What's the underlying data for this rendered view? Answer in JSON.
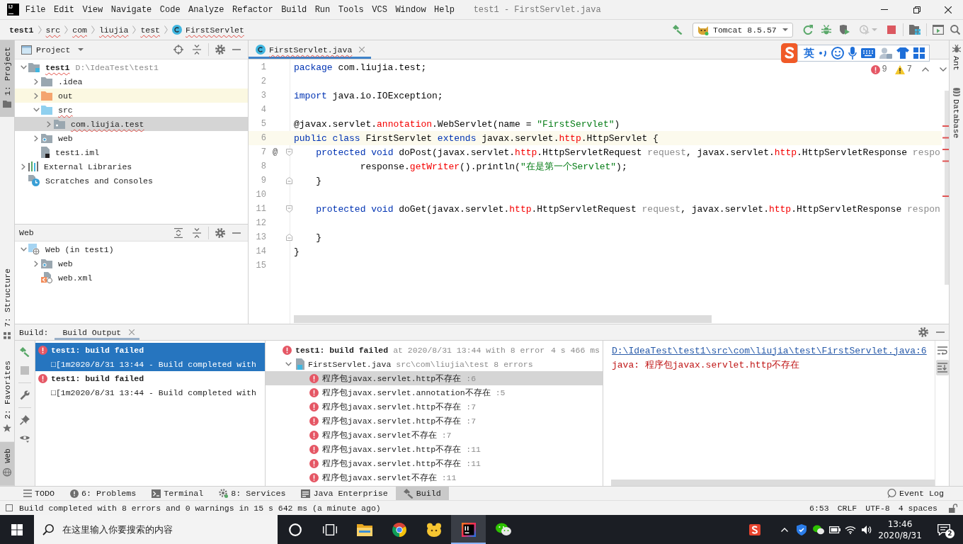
{
  "window": {
    "logo": "IJ",
    "menu": [
      "File",
      "Edit",
      "View",
      "Navigate",
      "Code",
      "Analyze",
      "Refactor",
      "Build",
      "Run",
      "Tools",
      "VCS",
      "Window",
      "Help"
    ],
    "title": "test1 - FirstServlet.java"
  },
  "navigation_bar": {
    "breadcrumbs": [
      {
        "label": "test1",
        "kind": "module",
        "misspelled": false
      },
      {
        "label": "src",
        "kind": "folder",
        "misspelled": true
      },
      {
        "label": "com",
        "kind": "folder",
        "misspelled": true
      },
      {
        "label": "liujia",
        "kind": "folder",
        "misspelled": true
      },
      {
        "label": "test",
        "kind": "folder",
        "misspelled": true
      },
      {
        "label": "FirstServlet",
        "kind": "class",
        "misspelled": true
      }
    ],
    "toolbar": [
      {
        "kind": "build",
        "disabled": false
      },
      {
        "kind": "run_configuration",
        "label": "Tomcat 8.5.57",
        "disabled": false
      },
      {
        "kind": "rerun",
        "disabled": false
      },
      {
        "kind": "debug",
        "disabled": false
      },
      {
        "kind": "coverage",
        "disabled": false
      },
      {
        "kind": "profile",
        "disabled": true
      },
      {
        "kind": "stop",
        "disabled": false
      },
      {
        "kind": "separator"
      },
      {
        "kind": "project_structure",
        "disabled": false
      },
      {
        "kind": "separator"
      },
      {
        "kind": "tool_window",
        "disabled": false
      },
      {
        "kind": "search",
        "disabled": false
      }
    ]
  },
  "left_stripe": {
    "top": [
      {
        "label": "1: Project",
        "kind": "project",
        "selected": true
      }
    ],
    "bottom": [
      {
        "label": "7: Structure",
        "kind": "structure",
        "selected": false
      },
      {
        "label": "2: Favorites",
        "kind": "favorites",
        "selected": false
      },
      {
        "label": "Web",
        "kind": "web",
        "selected": true
      }
    ]
  },
  "project_panel": {
    "title": "Project",
    "tree": [
      {
        "label": "test1",
        "path": "D:\\IdeaTest\\test1",
        "kind": "module",
        "expanded": true,
        "selected": false,
        "highlighted": false,
        "misspelled": true,
        "children": [
          {
            "label": ".idea",
            "kind": "folder",
            "expanded": false,
            "selected": false,
            "highlighted": false,
            "misspelled": false
          },
          {
            "label": "out",
            "kind": "excluded_folder",
            "expanded": false,
            "selected": false,
            "highlighted": true,
            "misspelled": false
          },
          {
            "label": "src",
            "kind": "source_folder",
            "expanded": true,
            "selected": false,
            "highlighted": false,
            "misspelled": true,
            "children": [
              {
                "label": "com.liujia.test",
                "kind": "package",
                "expanded": false,
                "selected": true,
                "highlighted": false,
                "misspelled": true
              }
            ]
          },
          {
            "label": "web",
            "kind": "web_folder",
            "expanded": false,
            "selected": false,
            "highlighted": false,
            "misspelled": false
          },
          {
            "label": "test1.iml",
            "kind": "module_file",
            "selected": false,
            "highlighted": false,
            "misspelled": false
          }
        ]
      },
      {
        "label": "External Libraries",
        "kind": "libraries",
        "expanded": false,
        "selected": false,
        "highlighted": false,
        "misspelled": false
      },
      {
        "label": "Scratches and Consoles",
        "kind": "scratches",
        "selected": false,
        "highlighted": false,
        "misspelled": false
      }
    ]
  },
  "web_panel": {
    "title": "Web",
    "tree": [
      {
        "label": "Web (in test1)",
        "kind": "web_facet",
        "expanded": true,
        "selected": false,
        "highlighted": false,
        "misspelled": false,
        "children": [
          {
            "label": "web",
            "kind": "web_folder",
            "expanded": false,
            "selected": false,
            "highlighted": false,
            "misspelled": false
          },
          {
            "label": "web.xml",
            "kind": "xml_file",
            "selected": false,
            "highlighted": false,
            "misspelled": false
          }
        ]
      }
    ]
  },
  "editor": {
    "tabs": [
      {
        "label": "FirstServlet.java",
        "selected": true,
        "misspelled": true
      }
    ],
    "error_count": "9",
    "warning_count": "7",
    "lines": [
      {
        "number": "1",
        "current": false,
        "tokens": [
          {
            "text": "package",
            "kind": "keyword"
          },
          {
            "text": " com.liujia.test;",
            "kind": "plain"
          }
        ]
      },
      {
        "number": "2",
        "current": false
      },
      {
        "number": "3",
        "current": false,
        "tokens": [
          {
            "text": "import",
            "kind": "keyword"
          },
          {
            "text": " java.io.IOException;",
            "kind": "plain"
          }
        ]
      },
      {
        "number": "4",
        "current": false
      },
      {
        "number": "5",
        "current": false,
        "tokens": [
          {
            "text": "@javax.servlet.",
            "kind": "plain"
          },
          {
            "text": "annotation",
            "kind": "error"
          },
          {
            "text": ".WebServlet(name = ",
            "kind": "plain"
          },
          {
            "text": "\"FirstServlet\"",
            "kind": "string"
          },
          {
            "text": ")",
            "kind": "plain"
          }
        ]
      },
      {
        "number": "6",
        "current": true,
        "tokens": [
          {
            "text": "public",
            "kind": "keyword"
          },
          {
            "text": " class",
            "kind": "keyword"
          },
          {
            "text": " FirstServlet ",
            "kind": "plain"
          },
          {
            "text": "extends",
            "kind": "keyword"
          },
          {
            "text": " javax.servlet.",
            "kind": "plain"
          },
          {
            "text": "http",
            "kind": "error"
          },
          {
            "text": ".HttpServlet {",
            "kind": "plain"
          }
        ]
      },
      {
        "number": "7",
        "current": false,
        "marker": "@",
        "fold": {
          "kind": "start"
        },
        "tokens": [
          {
            "text": "    protected",
            "kind": "keyword"
          },
          {
            "text": " void",
            "kind": "keyword"
          },
          {
            "text": " doPost(javax.servlet.",
            "kind": "plain"
          },
          {
            "text": "http",
            "kind": "error"
          },
          {
            "text": ".HttpServletRequest ",
            "kind": "plain"
          },
          {
            "text": "request",
            "kind": "parameter"
          },
          {
            "text": ", javax.servlet.",
            "kind": "plain"
          },
          {
            "text": "http",
            "kind": "error"
          },
          {
            "text": ".HttpServletResponse ",
            "kind": "plain"
          },
          {
            "text": "respo",
            "kind": "parameter"
          }
        ]
      },
      {
        "number": "8",
        "current": false,
        "tokens": [
          {
            "text": "            response.",
            "kind": "plain"
          },
          {
            "text": "getWriter",
            "kind": "error"
          },
          {
            "text": "().println(",
            "kind": "plain"
          },
          {
            "text": "\"在是第一个Servlet\"",
            "kind": "string"
          },
          {
            "text": ");",
            "kind": "plain"
          }
        ]
      },
      {
        "number": "9",
        "current": false,
        "fold": {
          "kind": "end"
        },
        "tokens": [
          {
            "text": "    }",
            "kind": "plain"
          }
        ]
      },
      {
        "number": "10",
        "current": false
      },
      {
        "number": "11",
        "current": false,
        "fold": {
          "kind": "start"
        },
        "tokens": [
          {
            "text": "    protected",
            "kind": "keyword"
          },
          {
            "text": " void",
            "kind": "keyword"
          },
          {
            "text": " doGet(javax.servlet.",
            "kind": "plain"
          },
          {
            "text": "http",
            "kind": "error"
          },
          {
            "text": ".HttpServletRequest ",
            "kind": "plain"
          },
          {
            "text": "request",
            "kind": "parameter"
          },
          {
            "text": ", javax.servlet.",
            "kind": "plain"
          },
          {
            "text": "http",
            "kind": "error"
          },
          {
            "text": ".HttpServletResponse ",
            "kind": "plain"
          },
          {
            "text": "respon",
            "kind": "parameter"
          }
        ]
      },
      {
        "number": "12",
        "current": false
      },
      {
        "number": "13",
        "current": false,
        "fold": {
          "kind": "end"
        },
        "tokens": [
          {
            "text": "    }",
            "kind": "plain"
          }
        ]
      },
      {
        "number": "14",
        "current": false,
        "tokens": [
          {
            "text": "}",
            "kind": "plain"
          }
        ]
      },
      {
        "number": "15",
        "current": false
      }
    ]
  },
  "ime_toolbar": {
    "mode": "英"
  },
  "right_stripe": [
    {
      "label": "Ant",
      "kind": "ant",
      "selected": false
    },
    {
      "label": "Database",
      "kind": "database",
      "selected": false
    }
  ],
  "build_panel": {
    "title": "Build:",
    "tabs": [
      {
        "label": "Build Output",
        "selected": true
      }
    ],
    "toolbar": [
      {
        "kind": "build",
        "disabled": false
      },
      {
        "kind": "stop",
        "disabled": true
      },
      {
        "kind": "separator"
      },
      {
        "kind": "settings",
        "disabled": false
      },
      {
        "kind": "separator"
      },
      {
        "kind": "pin",
        "disabled": false
      },
      {
        "kind": "view",
        "disabled": false
      }
    ],
    "sessions": [
      {
        "title": "test1: build failed",
        "message": "□[1m2020/8/31 13:44 - Build completed with",
        "kind": "error",
        "selected": true
      },
      {
        "title": "test1: build failed",
        "message": "□[1m2020/8/31 13:44 - Build completed with",
        "kind": "error",
        "selected": false
      }
    ],
    "tree": [
      {
        "label": "test1: build failed",
        "detail": "at 2020/8/31 13:44 with 8 error",
        "duration": "4 s 466 ms",
        "kind": "error",
        "selected": false,
        "children": [
          {
            "label": "FirstServlet.java",
            "detail": "src\\com\\liujia\\test 8 errors",
            "kind": "java_file",
            "expanded": true,
            "selected": false,
            "children": [
              {
                "label": "程序包javax.servlet.http不存在",
                "detail": ":6",
                "kind": "error",
                "selected": true
              },
              {
                "label": "程序包javax.servlet.annotation不存在",
                "detail": ":5",
                "kind": "error",
                "selected": false
              },
              {
                "label": "程序包javax.servlet.http不存在",
                "detail": ":7",
                "kind": "error",
                "selected": false
              },
              {
                "label": "程序包javax.servlet.http不存在",
                "detail": ":7",
                "kind": "error",
                "selected": false
              },
              {
                "label": "程序包javax.servlet不存在",
                "detail": ":7",
                "kind": "error",
                "selected": false
              },
              {
                "label": "程序包javax.servlet.http不存在",
                "detail": ":11",
                "kind": "error",
                "selected": false
              },
              {
                "label": "程序包javax.servlet.http不存在",
                "detail": ":11",
                "kind": "error",
                "selected": false
              },
              {
                "label": "程序包javax.servlet不存在",
                "detail": ":11",
                "kind": "error",
                "selected": false
              }
            ]
          }
        ]
      }
    ],
    "console": {
      "link": "D:\\IdeaTest\\test1\\src\\com\\liujia\\test\\FirstServlet.java:6",
      "message": "java: 程序包javax.servlet.http不存在"
    },
    "console_actions": [
      {
        "kind": "soft_wrap",
        "on": false
      },
      {
        "kind": "scroll_to_end",
        "on": true
      }
    ]
  },
  "tool_window_bar": {
    "left": [
      {
        "label": "TODO",
        "kind": "todo",
        "selected": false
      },
      {
        "label": "6: Problems",
        "kind": "problems",
        "selected": false
      },
      {
        "label": "Terminal",
        "kind": "terminal",
        "selected": false
      },
      {
        "label": "8: Services",
        "kind": "services",
        "selected": false
      },
      {
        "label": "Java Enterprise",
        "kind": "java_enterprise",
        "selected": false
      },
      {
        "label": "Build",
        "kind": "build",
        "selected": true
      }
    ],
    "right": [
      {
        "label": "Event Log",
        "kind": "event_log",
        "selected": false
      }
    ]
  },
  "status_bar": {
    "message": "Build completed with 8 errors and 0 warnings in 15 s 642 ms (a minute ago)",
    "widgets": [
      "6:53",
      "CRLF",
      "UTF-8",
      "4 spaces"
    ]
  },
  "taskbar": {
    "search": {
      "placeholder": "在这里输入你要搜索的内容"
    },
    "apps": [
      {
        "kind": "assistant",
        "active": false
      },
      {
        "kind": "task_view",
        "active": false
      },
      {
        "kind": "file_explorer",
        "active": false
      },
      {
        "kind": "browser",
        "active": false
      },
      {
        "kind": "mascot_app",
        "active": false
      },
      {
        "kind": "ide",
        "active": true
      },
      {
        "kind": "chat",
        "active": false
      }
    ],
    "tray": [
      {
        "kind": "ime"
      },
      {
        "kind": "overflow"
      },
      {
        "kind": "security"
      },
      {
        "kind": "chat"
      },
      {
        "kind": "battery"
      },
      {
        "kind": "network"
      },
      {
        "kind": "volume"
      }
    ],
    "time": "13:46",
    "date": "2020/8/31",
    "notification_count": "2"
  }
}
